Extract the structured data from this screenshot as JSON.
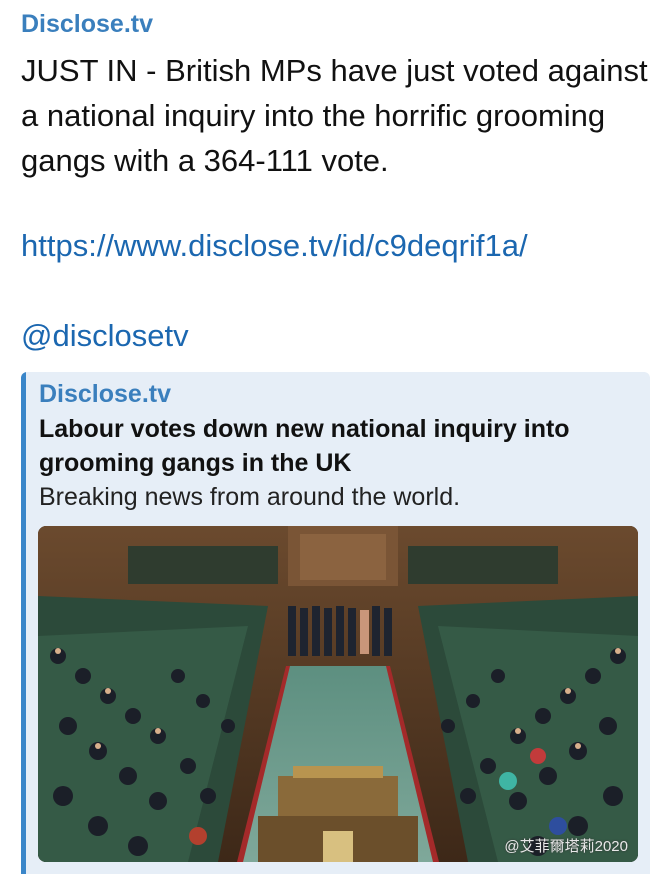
{
  "message": {
    "sender": "Disclose.tv",
    "text": "JUST IN - British MPs have just voted against a national inquiry into the horrific grooming gangs with a 364-111 vote.",
    "link": "https://www.disclose.tv/id/c9deqrif1a/",
    "mention": "@disclosetv"
  },
  "preview": {
    "site_name": "Disclose.tv",
    "title": "Labour votes down new national inquiry into grooming gangs in the UK",
    "description": "Breaking news from around the world.",
    "image_icon": "house-of-commons-chamber-photo"
  },
  "watermark": {
    "text": "@艾菲爾塔莉2020"
  },
  "colors": {
    "accent": "#3a7fbd",
    "link": "#1b67b0",
    "preview_bg": "#e6eef7",
    "preview_bar": "#3a86c9"
  }
}
